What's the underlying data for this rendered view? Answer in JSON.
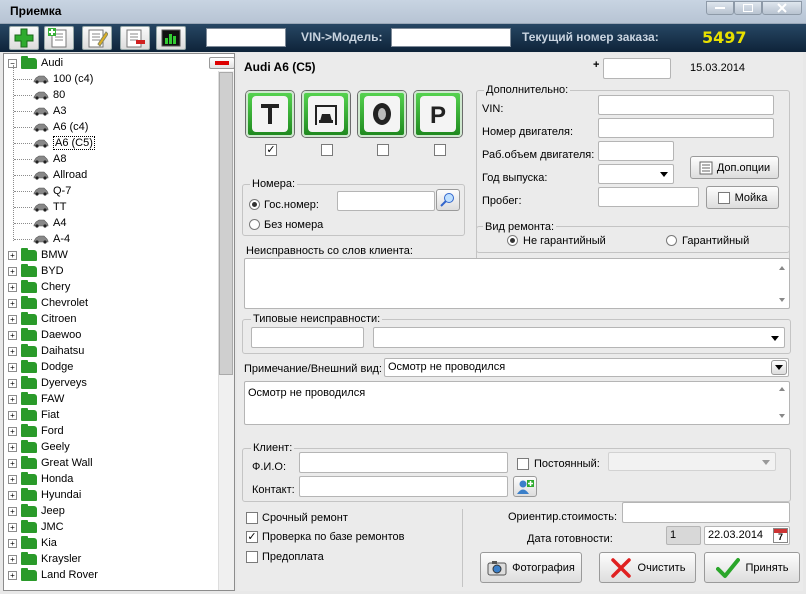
{
  "window": {
    "title": "Приемка"
  },
  "toolbar": {
    "vin_label": "VIN->Модель:",
    "order_label": "Текущий номер заказа:",
    "order_number": "5497"
  },
  "tree": {
    "root": "Audi",
    "models": [
      "100 (c4)",
      "80",
      "A3",
      "A6 (c4)",
      "A6 (C5)",
      "A8",
      "Allroad",
      "Q-7",
      "TT",
      "A4",
      "A-4"
    ],
    "selected_model": "A6 (C5)",
    "brands": [
      "BMW",
      "BYD",
      "Chery",
      "Chevrolet",
      "Citroen",
      "Daewoo",
      "Daihatsu",
      "Dodge",
      "Dyerveys",
      "FAW",
      "Fiat",
      "Ford",
      "Geely",
      "Great Wall",
      "Honda",
      "Hyundai",
      "Jeep",
      "JMC",
      "Kia",
      "Kraysler",
      "Land Rover"
    ]
  },
  "main": {
    "car_title": "Audi  A6 (C5)",
    "plus": "+",
    "plus_value": "",
    "date": "15.03.2014",
    "service_icons": [
      "lift-icon",
      "carwash-icon",
      "tire-icon",
      "parking-icon"
    ],
    "service_checks": [
      true,
      false,
      false,
      false
    ],
    "plates": {
      "legend": "Номера:",
      "gov_label": "Гос.номер:",
      "gov_value": "",
      "none_label": "Без номера",
      "selected": "gov"
    },
    "extra": {
      "legend": "Дополнительно:",
      "vin_label": "VIN:",
      "engine_label": "Номер двигателя:",
      "volume_label": "Раб.объем двигателя:",
      "year_label": "Год выпуска:",
      "mileage_label": "Пробег:",
      "options_button": "Доп.опции",
      "wash_label": "Мойка",
      "wash_checked": false
    },
    "repair_type": {
      "legend": "Вид ремонта:",
      "non_warranty": "Не гарантийный",
      "warranty": "Гарантийный",
      "selected": "non_warranty"
    },
    "client_issue_label": "Неисправность со слов клиента:",
    "client_issue_value": "",
    "typical": {
      "legend": "Типовые неисправности:"
    },
    "note_label": "Примечание/Внешний вид:",
    "note_select": "Осмотр не проводился",
    "note_text": "Осмотр не проводился",
    "client": {
      "legend": "Клиент:",
      "name_label": "Ф.И.О:",
      "contact_label": "Контакт:",
      "permanent_label": "Постоянный:"
    },
    "options": {
      "urgent": "Срочный ремонт",
      "urgent_checked": false,
      "check_db": "Проверка по базе ремонтов",
      "check_db_checked": true,
      "prepay": "Предоплата",
      "prepay_checked": false
    },
    "cost_label": "Ориентир.стоимость:",
    "ready_label": "Дата готовности:",
    "ready_days": "1",
    "ready_date": "22.03.2014",
    "calendar_day": "7",
    "buttons": {
      "photo": "Фотография",
      "clear": "Очистить",
      "accept": "Принять"
    }
  }
}
